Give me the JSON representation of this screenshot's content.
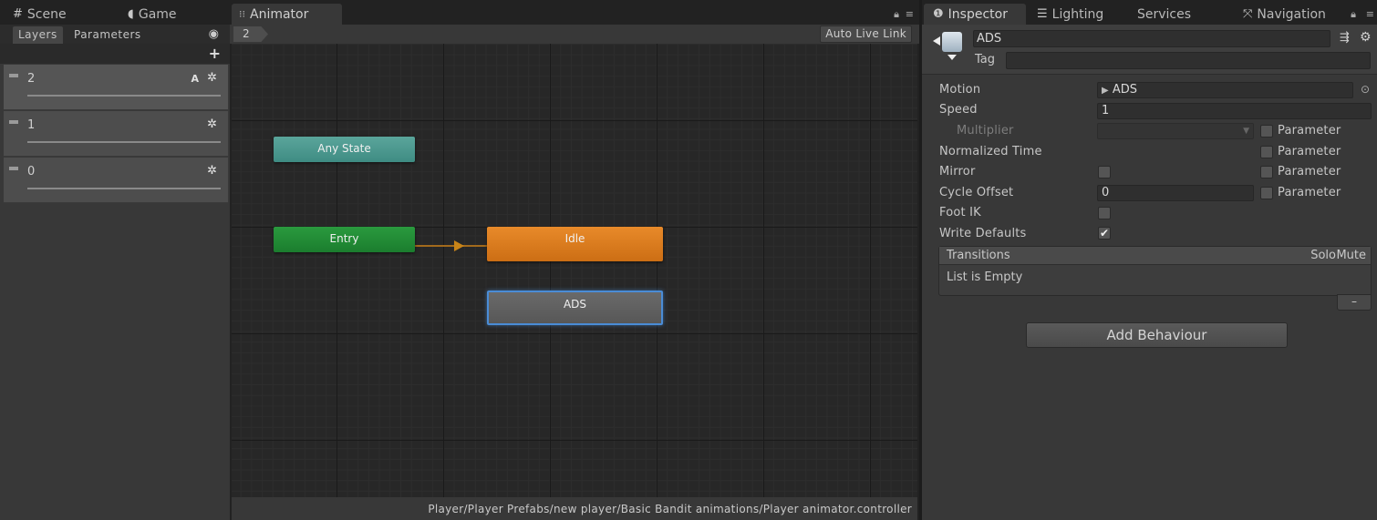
{
  "left_tabs": {
    "scene": "Scene",
    "game": "Game"
  },
  "layers_panel": {
    "tab_layers": "Layers",
    "tab_parameters": "Parameters",
    "add_label": "+",
    "layers": [
      {
        "name": "2",
        "badge": "A"
      },
      {
        "name": "1"
      },
      {
        "name": "0"
      }
    ]
  },
  "animator": {
    "tab_label": "Animator",
    "breadcrumb": "2",
    "auto_live_link": "Auto Live Link",
    "states": {
      "any_state": "Any State",
      "entry": "Entry",
      "idle": "Idle",
      "ads": "ADS"
    },
    "path": "Player/Player Prefabs/new player/Basic Bandit animations/Player animator.controller"
  },
  "inspector_tabs": {
    "inspector": "Inspector",
    "lighting": "Lighting",
    "services": "Services",
    "navigation": "Navigation"
  },
  "inspector": {
    "name": "ADS",
    "tag_label": "Tag",
    "motion_label": "Motion",
    "motion_value": "ADS",
    "speed_label": "Speed",
    "speed_value": "1",
    "multiplier_label": "Multiplier",
    "normalized_time_label": "Normalized Time",
    "mirror_label": "Mirror",
    "cycle_offset_label": "Cycle Offset",
    "cycle_offset_value": "0",
    "foot_ik_label": "Foot IK",
    "write_defaults_label": "Write Defaults",
    "write_defaults_checked": true,
    "parameter_label": "Parameter",
    "transitions": {
      "title": "Transitions",
      "solo": "Solo",
      "mute": "Mute",
      "empty": "List is Empty",
      "remove": "–"
    },
    "add_behaviour": "Add Behaviour"
  },
  "colors": {
    "any_state": "#4f9c92",
    "entry": "#23903a",
    "idle": "#e07f22",
    "ads_selected_border": "#4a8cd6"
  }
}
